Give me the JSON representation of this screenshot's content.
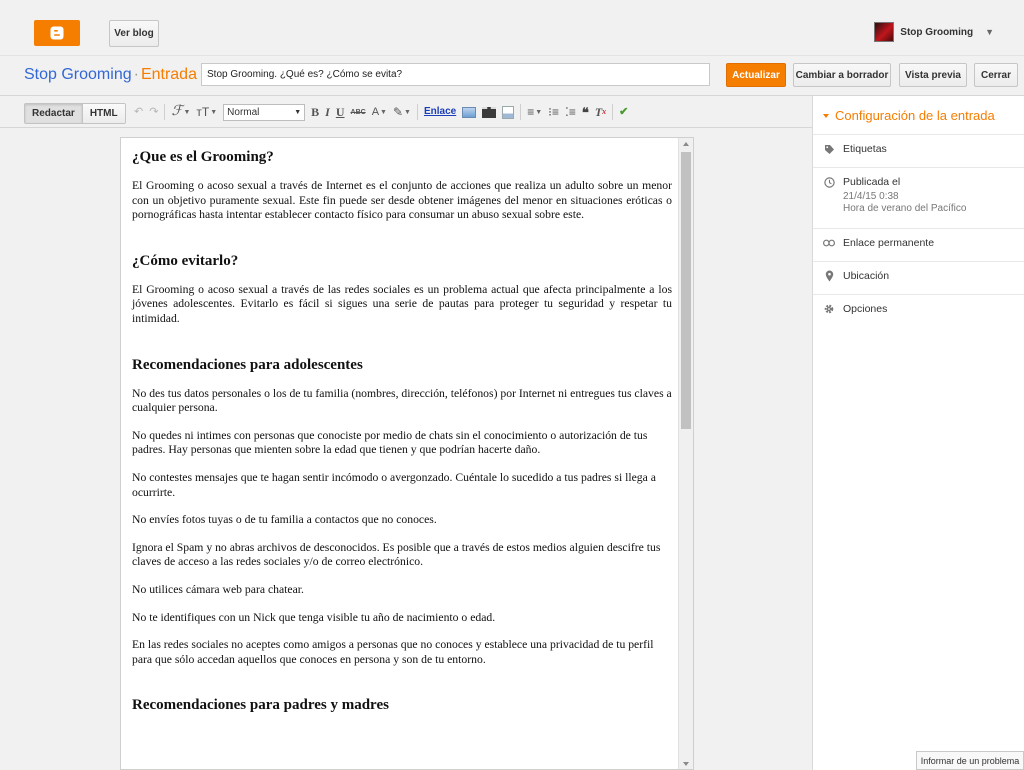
{
  "header": {
    "logo_icon": "blogger-logo-icon",
    "view_blog_label": "Ver blog",
    "user_name": "Stop Grooming"
  },
  "titlebar": {
    "blog_name": "Stop Grooming",
    "separator": "·",
    "kind": "Entrada",
    "post_title": "Stop Grooming. ¿Qué es? ¿Cómo se evita?",
    "update_label": "Actualizar",
    "draft_label": "Cambiar a borrador",
    "preview_label": "Vista previa",
    "close_label": "Cerrar"
  },
  "toolbar": {
    "compose_label": "Redactar",
    "html_label": "HTML",
    "font_format": "Normal",
    "link_label": "Enlace",
    "font_icon": "ℱ",
    "size_icon": "тT",
    "bold_icon": "B",
    "italic_icon": "I",
    "underline_icon": "U",
    "strike_icon": "ABC",
    "textcolor_icon": "A",
    "quote_icon": "❝"
  },
  "content": {
    "h1": "¿Que es el Grooming?",
    "p1": "El Grooming o acoso sexual a través de Internet es el conjunto de acciones que realiza un adulto sobre un menor con un objetivo puramente sexual. Este fin puede ser desde obtener imágenes del menor en situaciones eróticas o pornográficas hasta intentar establecer contacto físico para consumar un abuso sexual sobre este.",
    "h2": "¿Cómo evitarlo?",
    "p2": "El Grooming o acoso sexual a través de las redes sociales es un problema actual que afecta principalmente a los jóvenes adolescentes. Evitarlo es fácil si sigues una serie de pautas para proteger tu seguridad y respetar tu intimidad.",
    "h3": "Recomendaciones para adolescentes",
    "items": [
      "No des tus datos personales o los de tu familia (nombres, dirección, teléfonos) por Internet ni entregues tus claves a cualquier persona.",
      "No quedes ni intimes con personas que conociste por medio de chats sin el conocimiento o autorización de tus padres. Hay personas que mienten sobre la edad que tienen y que podrían hacerte daño.",
      "No contestes mensajes que te hagan sentir incómodo o avergonzado. Cuéntale lo sucedido a tus padres si llega a ocurrirte.",
      "No envíes fotos tuyas o de tu familia a contactos que no conoces.",
      "Ignora el Spam y no abras archivos de desconocidos. Es posible que a través de estos medios alguien descifre tus claves de acceso a las redes sociales y/o de correo electrónico.",
      "No utilices cámara web para chatear.",
      "No te identifiques con un Nick que tenga visible tu año de nacimiento o edad.",
      "En las redes sociales no aceptes como amigos a personas que no conoces y establece una privacidad de tu perfil para que sólo accedan aquellos que conoces en persona y son de tu entorno."
    ],
    "h4": "Recomendaciones para padres y madres"
  },
  "sidebar": {
    "title": "Configuración de la entrada",
    "labels": "Etiquetas",
    "published": "Publicada el",
    "published_date": "21/4/15 0:38",
    "published_tz": "Hora de verano del Pacífico",
    "permalink": "Enlace permanente",
    "location": "Ubicación",
    "options": "Opciones"
  },
  "footer": {
    "report_label": "Informar de un problema"
  },
  "colors": {
    "accent": "#f57d00",
    "link_blue": "#3367d6"
  }
}
